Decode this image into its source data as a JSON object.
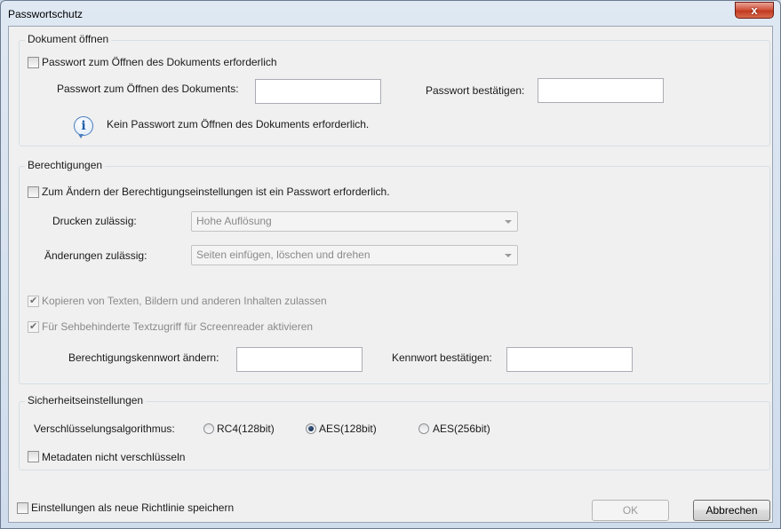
{
  "window": {
    "title": "Passwortschutz",
    "close_label": "x"
  },
  "document_open": {
    "legend": "Dokument öffnen",
    "require_password_label": "Passwort zum Öffnen des Dokuments erforderlich",
    "password_label": "Passwort zum Öffnen des Dokuments:",
    "password_value": "",
    "confirm_label": "Passwort bestätigen:",
    "confirm_value": "",
    "info_text": "Kein Passwort zum Öffnen des Dokuments erforderlich."
  },
  "permissions": {
    "legend": "Berechtigungen",
    "require_password_label": "Zum Ändern der Berechtigungseinstellungen ist ein Passwort erforderlich.",
    "print_label": "Drucken zulässig:",
    "print_value": "Hohe Auflösung",
    "changes_label": "Änderungen zulässig:",
    "changes_value": "Seiten einfügen, löschen und drehen",
    "copy_label": "Kopieren von Texten, Bildern und anderen Inhalten zulassen",
    "screenreader_label": "Für Sehbehinderte Textzugriff für Screenreader aktivieren",
    "change_password_label": "Berechtigungskennwort ändern:",
    "change_password_value": "",
    "confirm_label": "Kennwort bestätigen:",
    "confirm_value": ""
  },
  "security": {
    "legend": "Sicherheitseinstellungen",
    "algorithm_label": "Verschlüsselungsalgorithmus:",
    "options": [
      "RC4(128bit)",
      "AES(128bit)",
      "AES(256bit)"
    ],
    "selected": "AES(128bit)",
    "metadata_label": "Metadaten nicht verschlüsseln"
  },
  "footer": {
    "save_policy_label": "Einstellungen als neue Richtlinie speichern",
    "ok_label": "OK",
    "cancel_label": "Abbrechen"
  }
}
